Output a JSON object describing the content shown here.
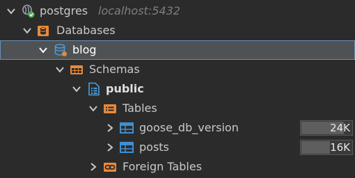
{
  "tree": {
    "server": {
      "label": "postgres",
      "host": "localhost:5432",
      "icon": "postgres-server-icon",
      "expanded": true
    },
    "databases": {
      "label": "Databases",
      "icon": "databases-folder-icon",
      "expanded": true
    },
    "db": {
      "label": "blog",
      "icon": "database-icon",
      "expanded": true,
      "selected": true
    },
    "schemas": {
      "label": "Schemas",
      "icon": "schemas-folder-icon",
      "expanded": true
    },
    "schema": {
      "label": "public",
      "icon": "schema-icon",
      "expanded": true
    },
    "tables": {
      "label": "Tables",
      "icon": "tables-folder-icon",
      "expanded": true
    },
    "table_rows": [
      {
        "label": "goose_db_version",
        "size": "24K",
        "size_fraction": 0.85,
        "icon": "table-icon",
        "expanded": false
      },
      {
        "label": "posts",
        "size": "16K",
        "size_fraction": 0.57,
        "icon": "table-icon",
        "expanded": false
      }
    ],
    "foreign_tables": {
      "label": "Foreign Tables",
      "icon": "foreign-tables-folder-icon",
      "expanded": false
    }
  },
  "colors": {
    "background": "#2b2b2b",
    "selection": "#4e5254",
    "selection_border": "#6b8fb5",
    "folder_orange": "#e8893a",
    "table_blue": "#3f8fd2",
    "postgres_green": "#4caf50"
  }
}
